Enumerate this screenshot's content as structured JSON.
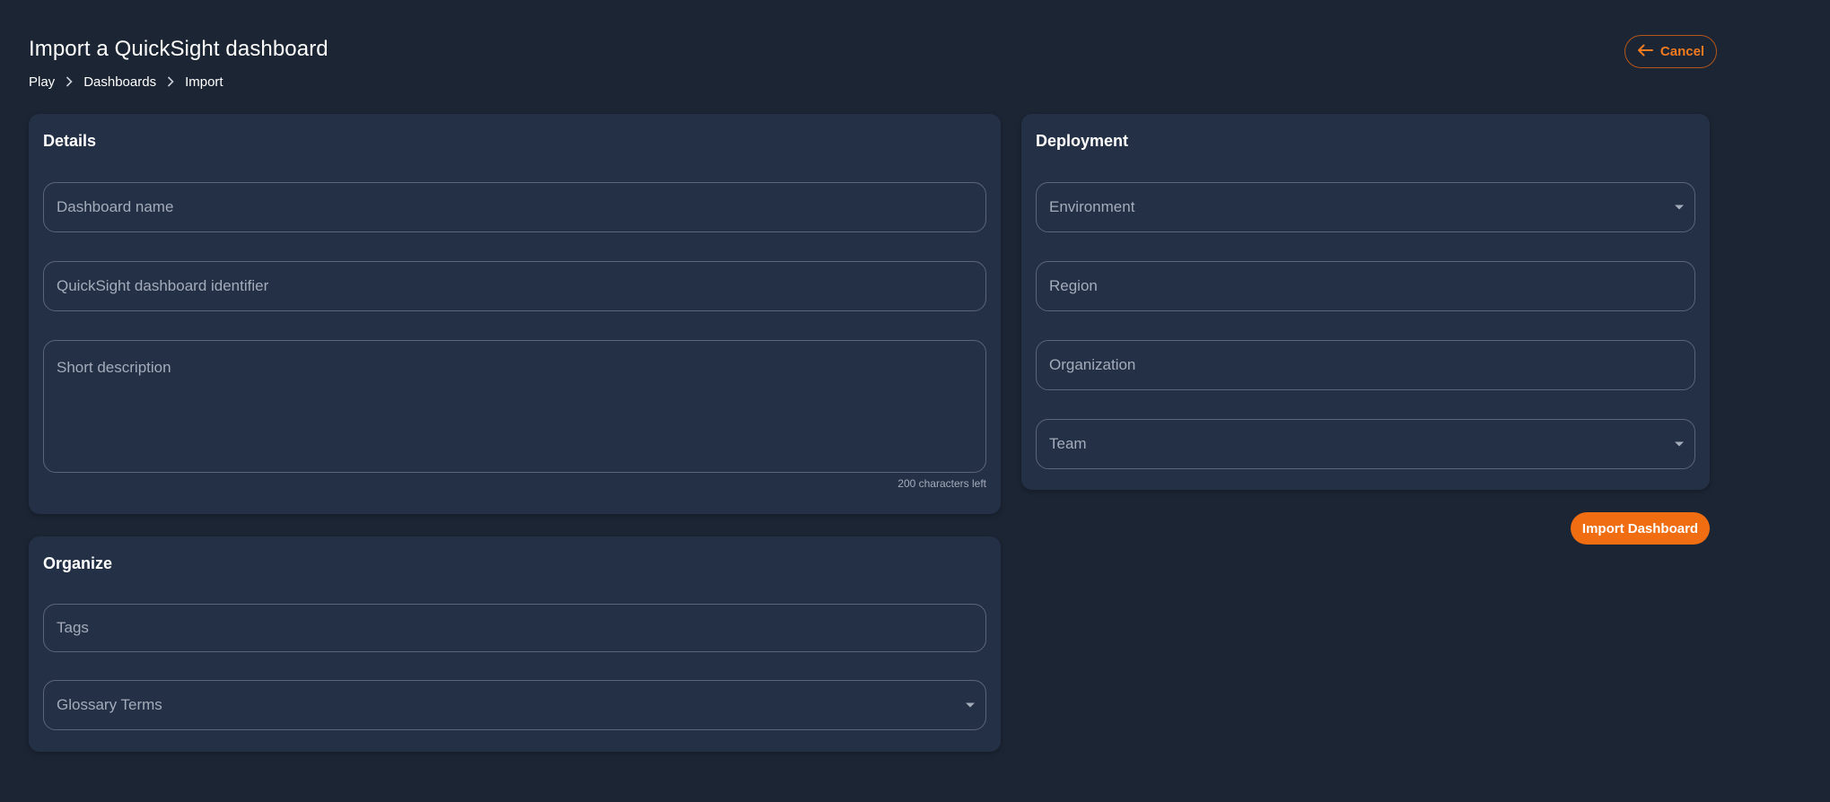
{
  "header": {
    "title": "Import a QuickSight dashboard",
    "breadcrumb": [
      "Play",
      "Dashboards",
      "Import"
    ],
    "cancel_label": "Cancel"
  },
  "details": {
    "title": "Details",
    "dashboard_name_placeholder": "Dashboard name",
    "identifier_placeholder": "QuickSight dashboard identifier",
    "description_placeholder": "Short description",
    "description_helper": "200 characters left"
  },
  "organize": {
    "title": "Organize",
    "tags_placeholder": "Tags",
    "glossary_placeholder": "Glossary Terms"
  },
  "deployment": {
    "title": "Deployment",
    "environment_placeholder": "Environment",
    "region_placeholder": "Region",
    "organization_placeholder": "Organization",
    "team_placeholder": "Team"
  },
  "actions": {
    "import_label": "Import Dashboard"
  },
  "colors": {
    "background": "#1c2534",
    "card": "#243046",
    "accent": "#f06d12",
    "border": "#5a6577"
  },
  "icons": {
    "cancel": "arrow-left-icon",
    "breadcrumb_separator": "chevron-right-icon",
    "select": "caret-down-icon"
  }
}
